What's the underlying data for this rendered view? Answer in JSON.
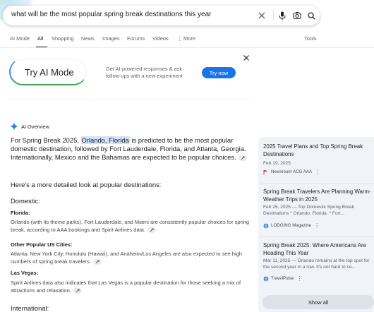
{
  "search": {
    "query": "what will be the most popular spring break destinations this year"
  },
  "tabs": [
    {
      "label": "AI Mode"
    },
    {
      "label": "All"
    },
    {
      "label": "Shopping"
    },
    {
      "label": "News"
    },
    {
      "label": "Images"
    },
    {
      "label": "Forums"
    },
    {
      "label": "Videos"
    },
    {
      "label": "More"
    },
    {
      "label": "Tools"
    }
  ],
  "promo": {
    "title": "Try AI Mode",
    "description": "Get AI-powered responses & ask follow-ups with a new experiment",
    "button": "Try now"
  },
  "overview": {
    "header": "AI Overview",
    "intro_before": "For Spring Break 2025, ",
    "intro_highlight": "Orlando, Florida",
    "intro_after": " is predicted to be the most popular domestic destination, followed by Fort Lauderdale, Florida, and Atlanta, Georgia. Internationally, Mexico and the Bahamas are expected to be popular choices.",
    "detail_intro": "Here's a more detailed look at popular destinations:",
    "domestic_heading": "Domestic:",
    "florida_heading": "Florida:",
    "florida_text": "Orlando (with its theme parks), Fort Lauderdale, and Miami are consistently popular choices for spring break, according to AAA bookings and Spirit Airlines data.",
    "us_cities_heading": "Other Popular US Cities:",
    "us_cities_text": "Atlanta, New York City, Honolulu (Hawaii), and Anaheim/Los Angeles are also expected to see high numbers of spring break travelers.",
    "vegas_heading": "Las Vegas:",
    "vegas_text": "Spirit Airlines data also indicates that Las Vegas is a popular destination for those seeking a mix of attractions and relaxation.",
    "international_heading": "International:"
  },
  "sources": [
    {
      "title": "2025 Travel Plans and Top Spring Break Destinations",
      "meta": "Feb 19, 2025",
      "source": "Newsroom ACG AAA"
    },
    {
      "title": "Spring Break Travelers Are Planning Warm-Weather Trips in 2025",
      "meta": "Feb 25, 2025 — Top Domestic Spring Break Destinations * Orlando, Florida. * Fort...",
      "source": "LODGING Magazine"
    },
    {
      "title": "Spring Break 2025: Where Americans Are Heading This Year",
      "meta": "Mar 11, 2025 — Orlando remains at the top spot for the second year in a row. It's not hard to se...",
      "source": "TravelPulse"
    }
  ],
  "show_all": "Show all",
  "colors": {
    "accent_blue": "#1a73e8",
    "highlight": "#d3e3fd",
    "side_panel": "#f0f4f9"
  }
}
